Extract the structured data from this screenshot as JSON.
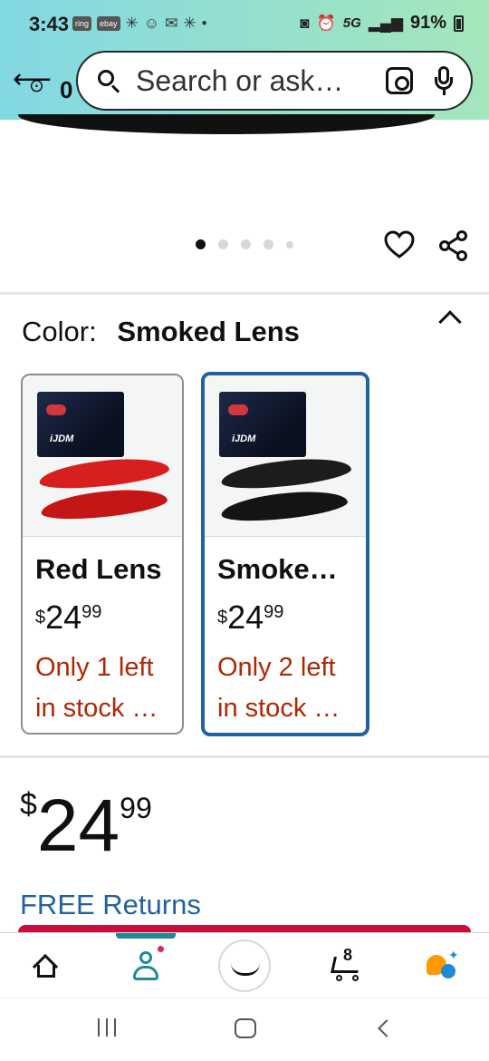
{
  "status_bar": {
    "time": "3:43",
    "mini_icons": [
      "ring",
      "ebay"
    ],
    "network": "5G",
    "battery": "91%"
  },
  "header": {
    "location_text": "0",
    "search_placeholder": "Search or ask…"
  },
  "gallery": {
    "dot_count": 5,
    "active_index": 0
  },
  "color_section": {
    "label": "Color:",
    "selected_value": "Smoked Lens",
    "options": [
      {
        "title": "Red Lens",
        "currency": "$",
        "price_whole": "24",
        "price_fraction": "99",
        "stock_line1": "Only 1 left",
        "stock_line2": "in stock …",
        "lens_color": "#d81f1f",
        "selected": false
      },
      {
        "title": "Smoke…",
        "currency": "$",
        "price_whole": "24",
        "price_fraction": "99",
        "stock_line1": "Only 2 left",
        "stock_line2": "in stock …",
        "lens_color": "#1c1c1c",
        "selected": true
      }
    ],
    "box_brand": "iJDM"
  },
  "price": {
    "currency": "$",
    "whole": "24",
    "fraction": "99"
  },
  "free_returns": "FREE Returns",
  "bottom_nav": {
    "cart_count": "8",
    "active": "account"
  },
  "colors": {
    "link_blue": "#2162a1",
    "stock_red": "#b12704",
    "accent_teal": "#1e8a95",
    "selected_border": "#2162a1"
  },
  "icons": [
    "back-arrow-icon",
    "location-pin-icon",
    "search-icon",
    "camera-lens-icon",
    "microphone-icon",
    "heart-icon",
    "share-icon",
    "chevron-up-icon",
    "home-icon",
    "account-icon",
    "amazon-smile-icon",
    "cart-icon",
    "rufus-icon"
  ]
}
